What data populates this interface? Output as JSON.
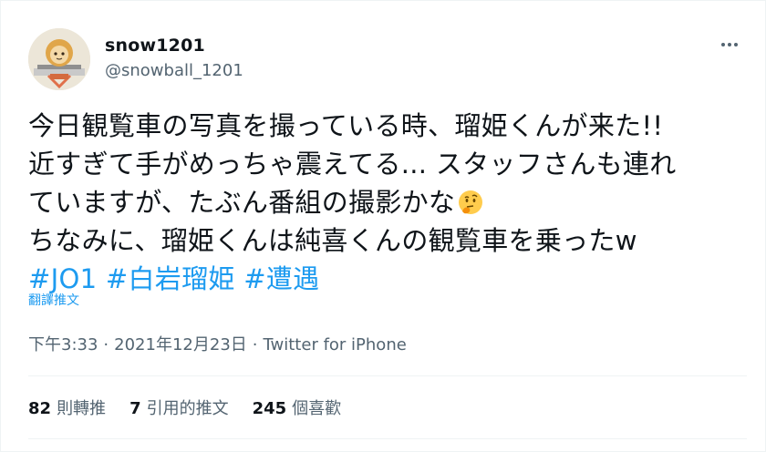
{
  "user": {
    "name": "snow1201",
    "handle": "@snowball_1201"
  },
  "tweet": {
    "lines": [
      "今日観覧車の写真を撮っている時、瑠姫くんが来た!!",
      "近すぎて手がめっちゃ震えてる... スタッフさんも連れ",
      "ていますが、たぶん番組の撮影かな",
      "ちなみに、瑠姫くんは純喜くんの観覧車を乗ったw"
    ],
    "emoji": "thinking-face-icon",
    "hashtags": [
      "#JO1",
      "#白岩瑠姫",
      "#遭遇"
    ]
  },
  "translate_label": "翻譯推文",
  "meta": {
    "time": "下午3:33",
    "separator": "·",
    "date": "2021年12月23日",
    "source": "Twitter for iPhone"
  },
  "stats": {
    "retweets": {
      "count": "82",
      "label": "則轉推"
    },
    "quotes": {
      "count": "7",
      "label": "引用的推文"
    },
    "likes": {
      "count": "245",
      "label": "個喜歡"
    }
  },
  "colors": {
    "link": "#1d9bf0",
    "text": "#0f1419",
    "secondary": "#536471",
    "divider": "#eff3f4"
  }
}
